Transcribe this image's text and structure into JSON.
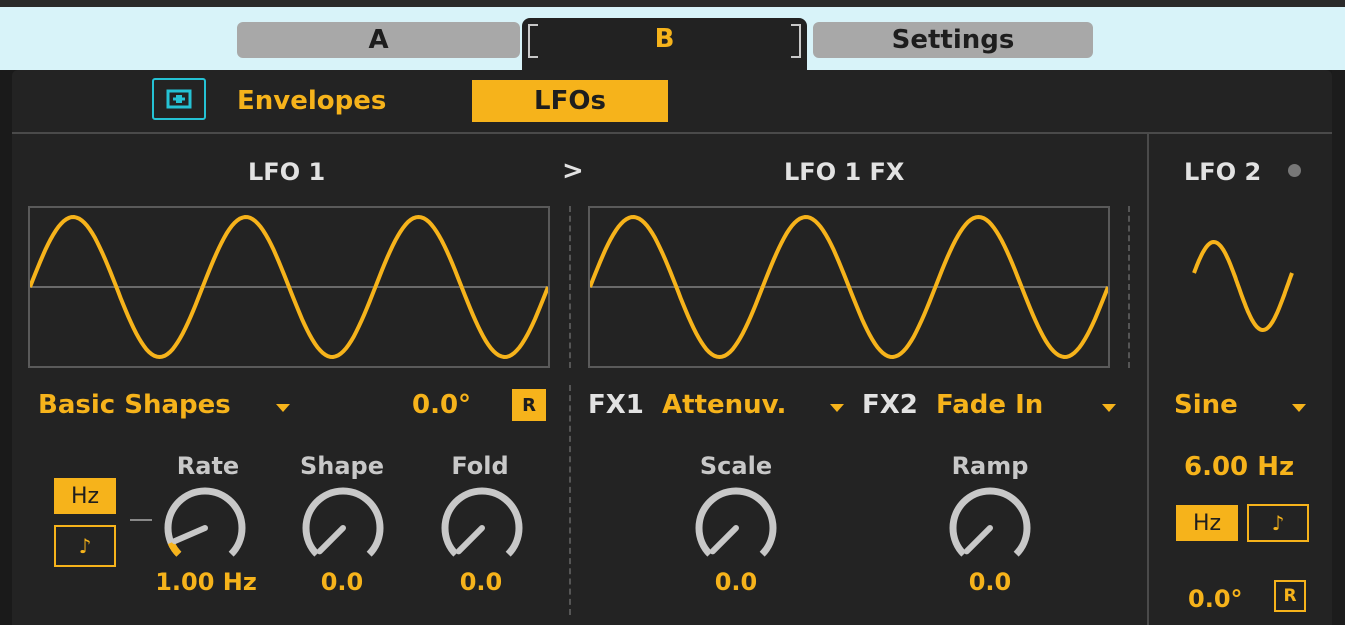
{
  "colors": {
    "accent": "#f6b31b",
    "cyan": "#25c2d4",
    "panel": "#232323",
    "tab_bg": "#d8f3f9"
  },
  "tabs": [
    {
      "label": "A",
      "active": false
    },
    {
      "label": "B",
      "active": true
    },
    {
      "label": "Settings",
      "active": false
    }
  ],
  "subtabs": {
    "icon": "device-toggle-icon",
    "envelopes": "Envelopes",
    "lfos": "LFOs",
    "active": "LFOs"
  },
  "lfo1": {
    "title": "LFO 1",
    "arrow": ">",
    "shape_menu": "Basic Shapes",
    "phase": "0.0°",
    "retrigger": "R",
    "hz_button": "Hz",
    "note_button": "♪",
    "knobs": [
      {
        "label": "Rate",
        "value": "1.00 Hz",
        "amount": 0.08
      },
      {
        "label": "Shape",
        "value": "0.0",
        "amount": 0.0
      },
      {
        "label": "Fold",
        "value": "0.0",
        "amount": 0.0
      }
    ]
  },
  "lfo1fx": {
    "title": "LFO 1 FX",
    "fx1_label": "FX1",
    "fx1_value": "Attenuv.",
    "fx2_label": "FX2",
    "fx2_value": "Fade In",
    "knobs": [
      {
        "label": "Scale",
        "value": "0.0",
        "amount": 0.0
      },
      {
        "label": "Ramp",
        "value": "0.0",
        "amount": 0.0
      }
    ]
  },
  "lfo2": {
    "title": "LFO 2",
    "shape": "Sine",
    "rate": "6.00 Hz",
    "hz_button": "Hz",
    "note_button": "♪",
    "phase": "0.0°",
    "retrigger": "R"
  }
}
